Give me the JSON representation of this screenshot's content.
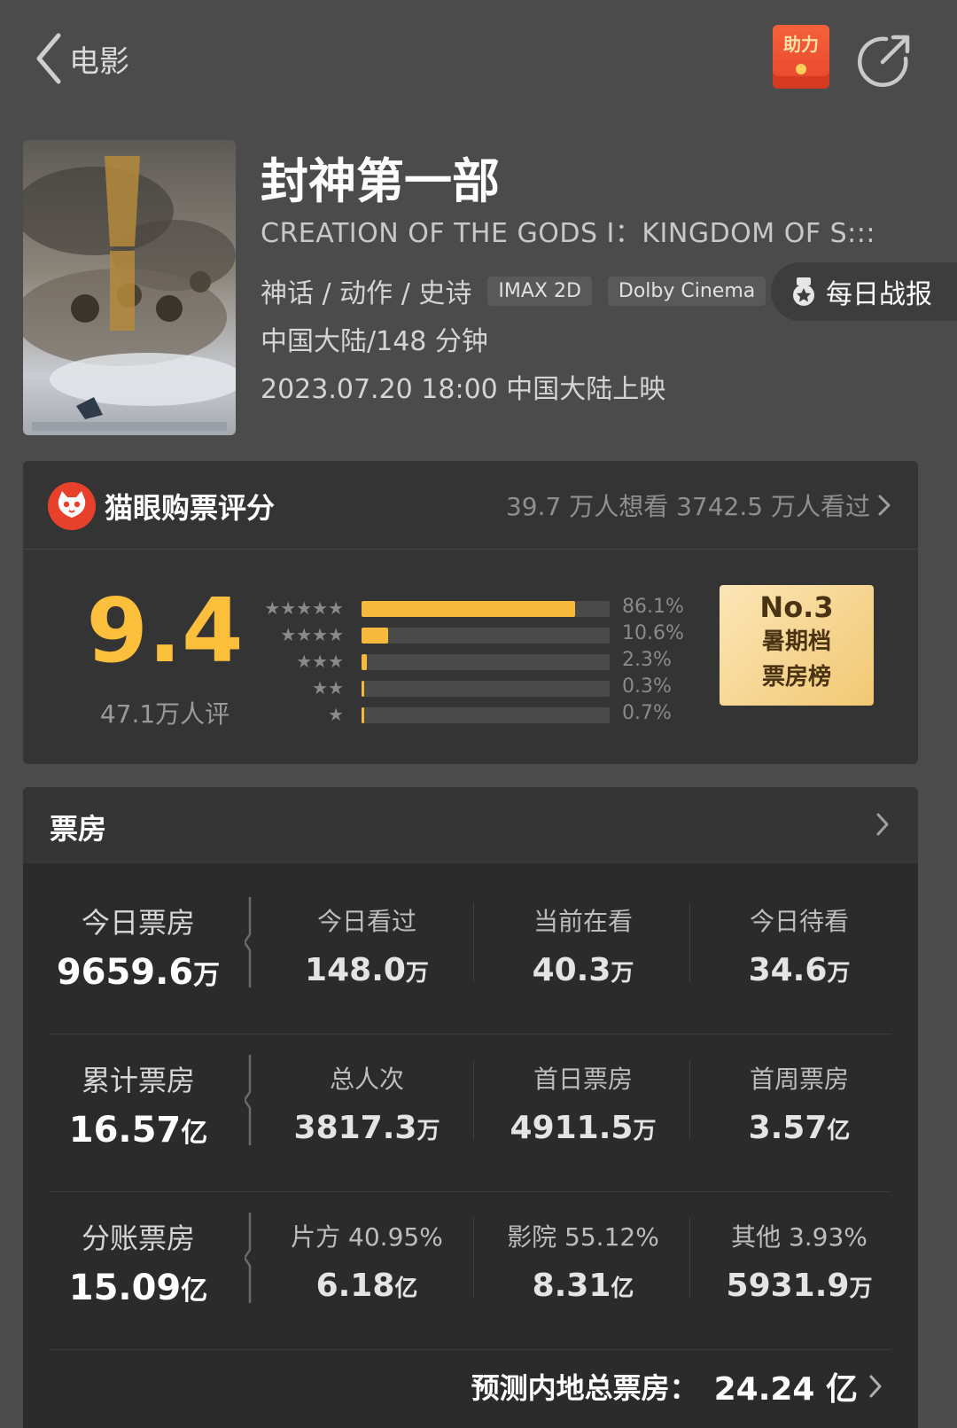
{
  "nav": {
    "back_label": "电影",
    "boost_label": "助力"
  },
  "movie": {
    "title": "封神第一部",
    "english_title": "CREATION OF THE GODS I：KINGDOM OF S:::",
    "genres": "神话 / 动作 / 史诗",
    "tags": [
      "IMAX 2D",
      "Dolby Cinema"
    ],
    "daily_report": "每日战报",
    "region_duration": "中国大陆/148 分钟",
    "release": "2023.07.20 18:00 中国大陆上映"
  },
  "rating": {
    "title": "猫眼购票评分",
    "want_watch": "39.7 万人想看  3742.5 万人看过",
    "score": "9.4",
    "raters": "47.1万人评",
    "distribution": [
      {
        "stars": "★★★★★",
        "percent": "86.1%",
        "value": 86.1
      },
      {
        "stars": "★★★★",
        "percent": "10.6%",
        "value": 10.6
      },
      {
        "stars": "★★★",
        "percent": "2.3%",
        "value": 2.3
      },
      {
        "stars": "★★",
        "percent": "0.3%",
        "value": 0.3
      },
      {
        "stars": "★",
        "percent": "0.7%",
        "value": 0.7
      }
    ],
    "rank": {
      "no": "No.3",
      "line1": "暑期档",
      "line2": "票房榜"
    }
  },
  "colors": {
    "accent_gold": "#fbbf3b",
    "bar_fill": "#f6b93b",
    "boost_red": "#e8452a"
  },
  "boxoffice": {
    "title": "票房",
    "rows": [
      {
        "main": {
          "label": "今日票房",
          "number": "9659.6",
          "unit": "万"
        },
        "cells": [
          {
            "label": "今日看过",
            "number": "148.0",
            "unit": "万"
          },
          {
            "label": "当前在看",
            "number": "40.3",
            "unit": "万"
          },
          {
            "label": "今日待看",
            "number": "34.6",
            "unit": "万"
          }
        ]
      },
      {
        "main": {
          "label": "累计票房",
          "number": "16.57",
          "unit": "亿"
        },
        "cells": [
          {
            "label": "总人次",
            "number": "3817.3",
            "unit": "万"
          },
          {
            "label": "首日票房",
            "number": "4911.5",
            "unit": "万"
          },
          {
            "label": "首周票房",
            "number": "3.57",
            "unit": "亿"
          }
        ]
      },
      {
        "main": {
          "label": "分账票房",
          "number": "15.09",
          "unit": "亿"
        },
        "cells": [
          {
            "label": "片方 40.95%",
            "number": "6.18",
            "unit": "亿"
          },
          {
            "label": "影院 55.12%",
            "number": "8.31",
            "unit": "亿"
          },
          {
            "label": "其他 3.93%",
            "number": "5931.9",
            "unit": "万"
          }
        ]
      }
    ],
    "forecast_label": "预测内地总票房：",
    "forecast_value": "24.24 亿"
  }
}
